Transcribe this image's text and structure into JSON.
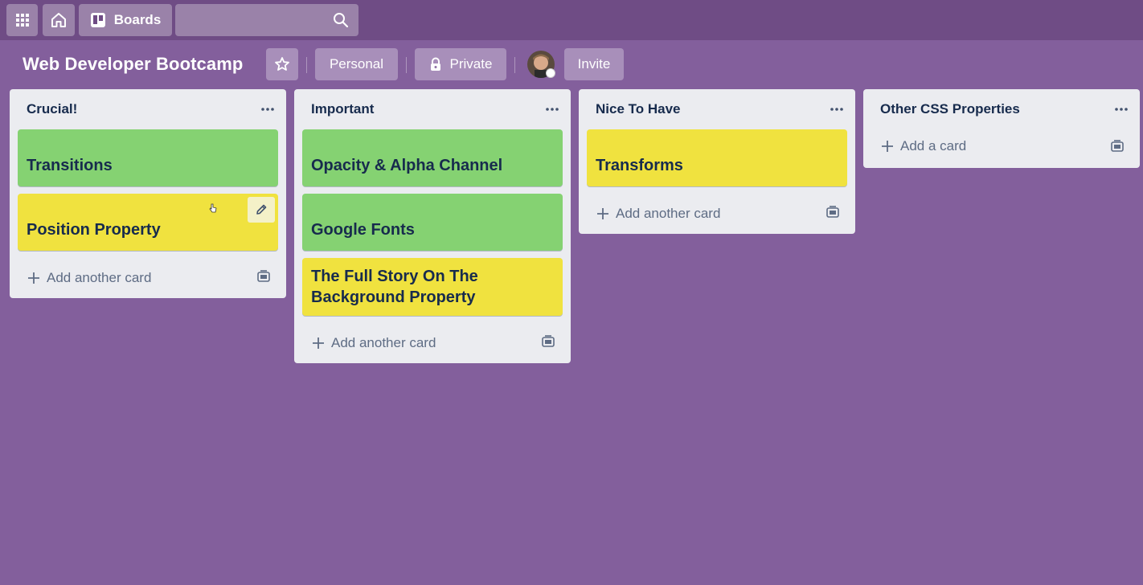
{
  "topbar": {
    "apps_icon": "grid-icon",
    "home_icon": "home-icon",
    "boards_label": "Boards",
    "search_placeholder": "",
    "search_icon": "search-icon"
  },
  "board": {
    "title": "Web Developer Bootcamp",
    "star_icon": "star-icon",
    "personal_label": "Personal",
    "private_label": "Private",
    "invite_label": "Invite"
  },
  "colors": {
    "background": "#835f9c",
    "topbar": "#6f4c85",
    "list_bg": "#ebecf0",
    "green_label": "#85d272",
    "yellow_label": "#f0e23f"
  },
  "lists": [
    {
      "title": "Crucial!",
      "cards": [
        {
          "title": "Transitions",
          "color": "green"
        },
        {
          "title": "Position Property",
          "color": "yellow"
        }
      ],
      "add_label": "Add another card"
    },
    {
      "title": "Important",
      "cards": [
        {
          "title": "Opacity & Alpha Channel",
          "color": "green"
        },
        {
          "title": "Google Fonts",
          "color": "green"
        },
        {
          "title": "The Full Story On The Background Property",
          "color": "yellow"
        }
      ],
      "add_label": "Add another card"
    },
    {
      "title": "Nice To Have",
      "cards": [
        {
          "title": "Transforms",
          "color": "yellow"
        }
      ],
      "add_label": "Add another card"
    },
    {
      "title": "Other CSS Properties",
      "cards": [],
      "add_label": "Add a card"
    }
  ]
}
